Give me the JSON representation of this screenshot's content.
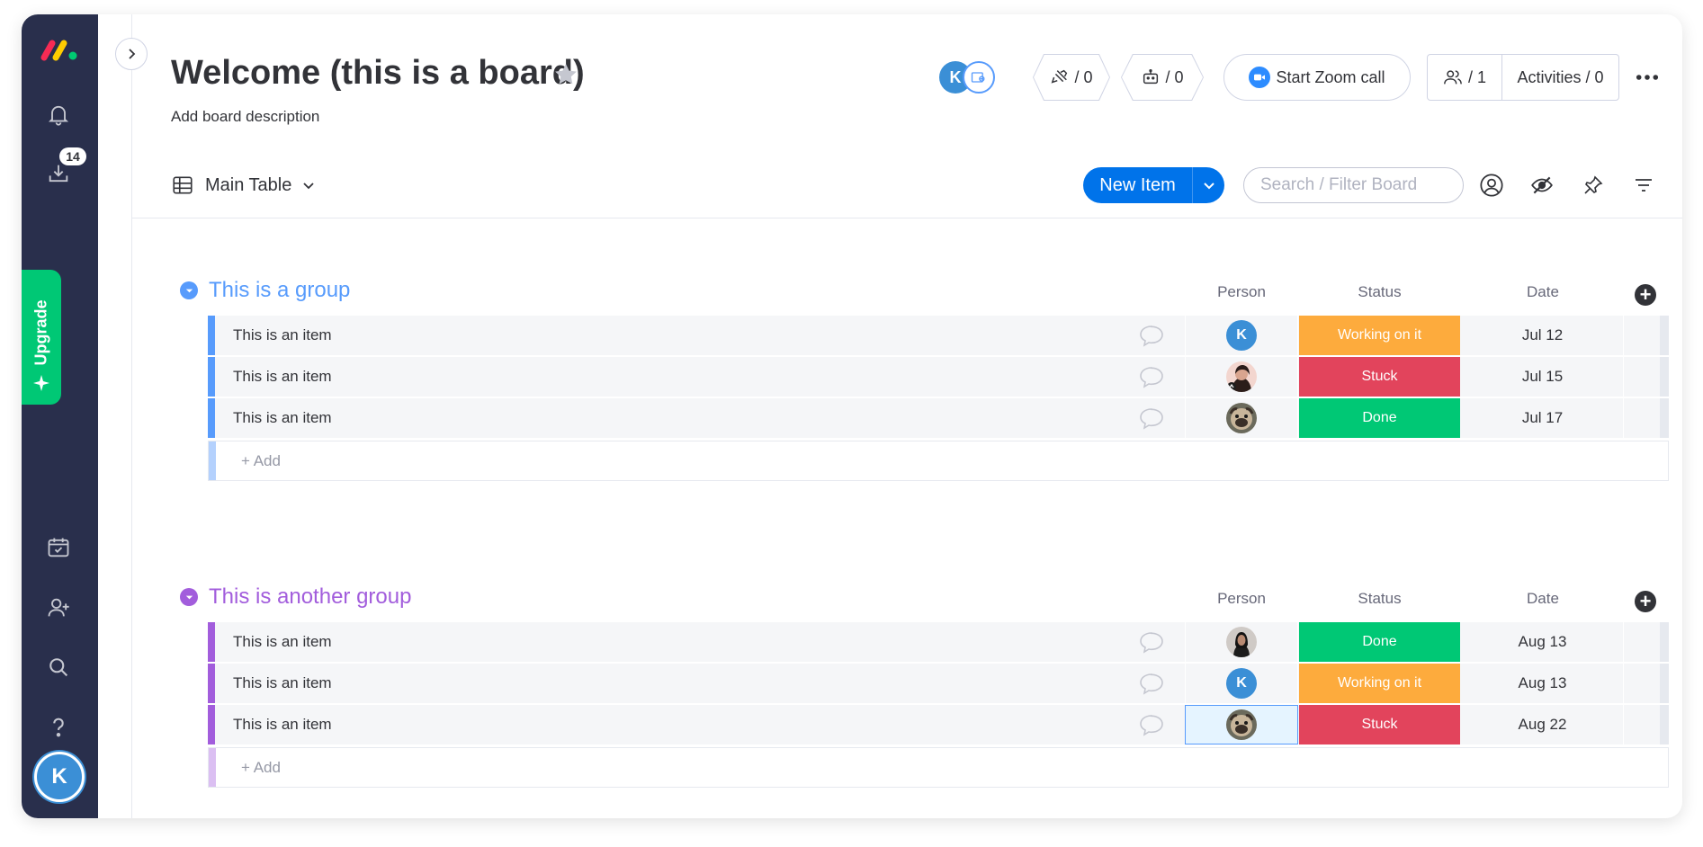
{
  "sidebar": {
    "inbox_badge": "14",
    "upgrade_label": "Upgrade",
    "user_initial": "K"
  },
  "header": {
    "title": "Welcome (this is a board)",
    "description": "Add board description",
    "viewer_initial": "K",
    "integrations_count": "/ 0",
    "automations_count": "/ 0",
    "zoom_label": "Start Zoom call",
    "members_count": "/ 1",
    "activities_label": "Activities / 0"
  },
  "toolbar": {
    "view_label": "Main Table",
    "new_item_label": "New Item",
    "search_placeholder": "Search / Filter Board"
  },
  "columns": {
    "person": "Person",
    "status": "Status",
    "date": "Date"
  },
  "groups": [
    {
      "title": "This is a group",
      "color": "#579bfc",
      "add_label": "+ Add",
      "items": [
        {
          "name": "This is an item",
          "person": "K",
          "status": "Working on it",
          "status_color": "#fdab3d",
          "date": "Jul 12"
        },
        {
          "name": "This is an item",
          "person": "photo-woman",
          "status": "Stuck",
          "status_color": "#e2445c",
          "date": "Jul 15"
        },
        {
          "name": "This is an item",
          "person": "photo-dog",
          "status": "Done",
          "status_color": "#00c875",
          "date": "Jul 17"
        }
      ]
    },
    {
      "title": "This is another group",
      "color": "#a25ddc",
      "add_label": "+ Add",
      "items": [
        {
          "name": "This is an item",
          "person": "photo-woman-dark",
          "status": "Done",
          "status_color": "#00c875",
          "date": "Aug 13"
        },
        {
          "name": "This is an item",
          "person": "K",
          "status": "Working on it",
          "status_color": "#fdab3d",
          "date": "Aug 13"
        },
        {
          "name": "This is an item",
          "person": "photo-dog",
          "status": "Stuck",
          "status_color": "#e2445c",
          "date": "Aug 22"
        }
      ]
    }
  ],
  "colors": {
    "nav_bg": "#292f4c",
    "primary": "#0073ea",
    "working": "#fdab3d",
    "stuck": "#e2445c",
    "done": "#00c875",
    "group1": "#579bfc",
    "group2": "#a25ddc"
  }
}
